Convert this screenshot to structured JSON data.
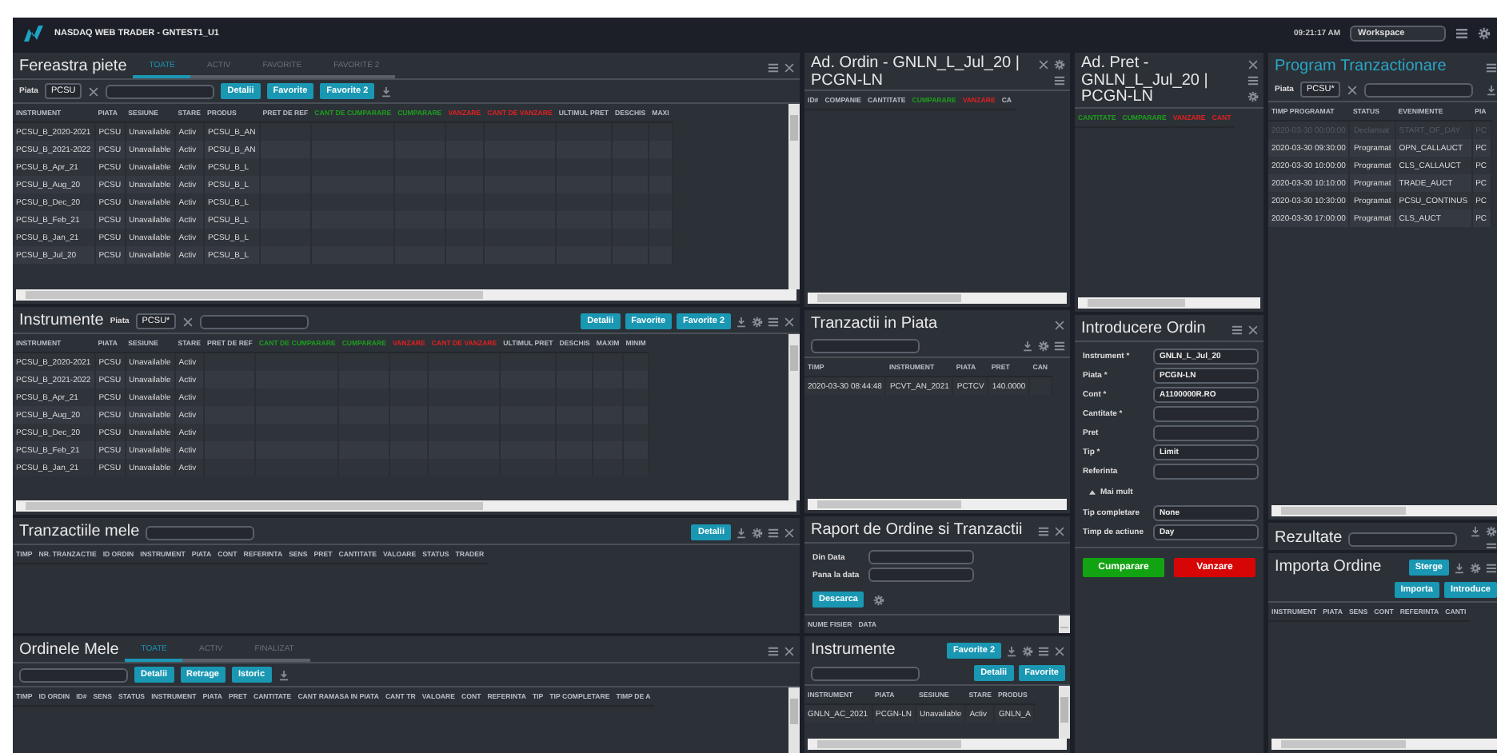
{
  "header": {
    "title": "NASDAQ WEB TRADER - GNTEST1_U1",
    "clock": "09:21:17 AM",
    "workspace": "Workspace",
    "tools": [
      {
        "kind": "menu"
      },
      {
        "kind": "settings"
      }
    ]
  },
  "workspace_columns": [
    {
      "panels": [
        {
          "title": "Fereastra piete",
          "tabs": [
            {
              "label": "TOATE",
              "selected": true
            },
            {
              "label": "ACTIV",
              "selected": false
            },
            {
              "label": "FAVORITE",
              "selected": false
            },
            {
              "label": "FAVORITE 2",
              "selected": false
            }
          ],
          "actions": [
            {
              "kind": "menu"
            },
            {
              "kind": "close"
            }
          ],
          "toolbar": [
            {
              "kind": "label",
              "label": "Piata"
            },
            {
              "kind": "select",
              "value": "PCSU"
            },
            {
              "kind": "clear"
            },
            {
              "kind": "search"
            },
            {
              "kind": "button",
              "label": "Detalii"
            },
            {
              "kind": "button",
              "label": "Favorite"
            },
            {
              "kind": "button",
              "label": "Favorite 2"
            },
            {
              "kind": "download"
            }
          ],
          "table": {
            "vscroll": true,
            "hscroll": true,
            "columns": [
              {
                "label": "INSTRUMENT"
              },
              {
                "label": "PIATA"
              },
              {
                "label": "SESIUNE"
              },
              {
                "label": "STARE"
              },
              {
                "label": "PRODUS"
              },
              {
                "label": "PRET DE REF"
              },
              {
                "label": "CANT DE CUMPARARE",
                "color": "#1e9e1e"
              },
              {
                "label": "CUMPARARE",
                "color": "#1e9e1e"
              },
              {
                "label": "VANZARE",
                "color": "#e02020"
              },
              {
                "label": "CANT DE VANZARE",
                "color": "#e02020"
              },
              {
                "label": "ULTIMUL PRET"
              },
              {
                "label": "DESCHIS"
              },
              {
                "label": "MAXI"
              }
            ],
            "rows": [
              {
                "cells": [
                  "PCSU_B_2020-2021",
                  "PCSU",
                  "Unavailable",
                  "Activ",
                  "PCSU_B_AN"
                ]
              },
              {
                "cells": [
                  "PCSU_B_2021-2022",
                  "PCSU",
                  "Unavailable",
                  "Activ",
                  "PCSU_B_AN"
                ]
              },
              {
                "cells": [
                  "PCSU_B_Apr_21",
                  "PCSU",
                  "Unavailable",
                  "Activ",
                  "PCSU_B_L"
                ]
              },
              {
                "cells": [
                  "PCSU_B_Aug_20",
                  "PCSU",
                  "Unavailable",
                  "Activ",
                  "PCSU_B_L"
                ]
              },
              {
                "cells": [
                  "PCSU_B_Dec_20",
                  "PCSU",
                  "Unavailable",
                  "Activ",
                  "PCSU_B_L"
                ]
              },
              {
                "cells": [
                  "PCSU_B_Feb_21",
                  "PCSU",
                  "Unavailable",
                  "Activ",
                  "PCSU_B_L"
                ]
              },
              {
                "cells": [
                  "PCSU_B_Jan_21",
                  "PCSU",
                  "Unavailable",
                  "Activ",
                  "PCSU_B_L"
                ]
              },
              {
                "cells": [
                  "PCSU_B_Jul_20",
                  "PCSU",
                  "Unavailable",
                  "Activ",
                  "PCSU_B_L"
                ]
              }
            ]
          }
        },
        {
          "title": "Instrumente",
          "filters": [
            {
              "kind": "label",
              "label": "Piata"
            },
            {
              "kind": "select",
              "value": "PCSU*"
            },
            {
              "kind": "clear"
            },
            {
              "kind": "search"
            }
          ],
          "actions": [
            {
              "kind": "button",
              "label": "Detalii"
            },
            {
              "kind": "button",
              "label": "Favorite"
            },
            {
              "kind": "button",
              "label": "Favorite 2"
            },
            {
              "kind": "download"
            },
            {
              "kind": "settings"
            },
            {
              "kind": "menu"
            },
            {
              "kind": "close"
            }
          ],
          "table": {
            "vscroll": true,
            "hscroll": true,
            "columns": [
              {
                "label": "INSTRUMENT"
              },
              {
                "label": "PIATA"
              },
              {
                "label": "SESIUNE"
              },
              {
                "label": "STARE"
              },
              {
                "label": "PRET DE REF"
              },
              {
                "label": "CANT DE CUMPARARE",
                "color": "#1e9e1e"
              },
              {
                "label": "CUMPARARE",
                "color": "#1e9e1e"
              },
              {
                "label": "VANZARE",
                "color": "#e02020"
              },
              {
                "label": "CANT DE VANZARE",
                "color": "#e02020"
              },
              {
                "label": "ULTIMUL PRET"
              },
              {
                "label": "DESCHIS"
              },
              {
                "label": "MAXIM"
              },
              {
                "label": "MINIM"
              }
            ],
            "rows": [
              {
                "cells": [
                  "PCSU_B_2020-2021",
                  "PCSU",
                  "Unavailable",
                  "Activ"
                ]
              },
              {
                "cells": [
                  "PCSU_B_2021-2022",
                  "PCSU",
                  "Unavailable",
                  "Activ"
                ]
              },
              {
                "cells": [
                  "PCSU_B_Apr_21",
                  "PCSU",
                  "Unavailable",
                  "Activ"
                ]
              },
              {
                "cells": [
                  "PCSU_B_Aug_20",
                  "PCSU",
                  "Unavailable",
                  "Activ"
                ]
              },
              {
                "cells": [
                  "PCSU_B_Dec_20",
                  "PCSU",
                  "Unavailable",
                  "Activ"
                ]
              },
              {
                "cells": [
                  "PCSU_B_Feb_21",
                  "PCSU",
                  "Unavailable",
                  "Activ"
                ]
              },
              {
                "cells": [
                  "PCSU_B_Jan_21",
                  "PCSU",
                  "Unavailable",
                  "Activ"
                ]
              }
            ]
          }
        },
        {
          "title": "Tranzactiile mele",
          "filters": [
            {
              "kind": "search"
            }
          ],
          "actions": [
            {
              "kind": "button",
              "label": "Detalii"
            },
            {
              "kind": "download"
            },
            {
              "kind": "settings"
            },
            {
              "kind": "menu"
            },
            {
              "kind": "close"
            }
          ],
          "table": {
            "columns": [
              {
                "label": "TIMP"
              },
              {
                "label": "NR. TRANZACTIE"
              },
              {
                "label": "ID ORDIN"
              },
              {
                "label": "INSTRUMENT"
              },
              {
                "label": "PIATA"
              },
              {
                "label": "CONT"
              },
              {
                "label": "REFERINTA"
              },
              {
                "label": "SENS"
              },
              {
                "label": "PRET"
              },
              {
                "label": "CANTITATE"
              },
              {
                "label": "VALOARE"
              },
              {
                "label": "STATUS"
              },
              {
                "label": "TRADER"
              }
            ]
          }
        },
        {
          "title": "Ordinele Mele",
          "tabs": [
            {
              "label": "TOATE",
              "selected": true
            },
            {
              "label": "ACTIV",
              "selected": false
            },
            {
              "label": "FINALIZAT",
              "selected": false
            }
          ],
          "actions": [
            {
              "kind": "menu"
            },
            {
              "kind": "close"
            }
          ],
          "toolbar": [
            {
              "kind": "search"
            },
            {
              "kind": "button",
              "label": "Detalii"
            },
            {
              "kind": "button",
              "label": "Retrage"
            },
            {
              "kind": "button",
              "label": "Istoric"
            },
            {
              "kind": "download"
            }
          ],
          "table": {
            "vscroll": true,
            "columns": [
              {
                "label": "TIMP"
              },
              {
                "label": "ID ORDIN"
              },
              {
                "label": "ID#"
              },
              {
                "label": "SENS"
              },
              {
                "label": "STATUS"
              },
              {
                "label": "INSTRUMENT"
              },
              {
                "label": "PIATA"
              },
              {
                "label": "PRET"
              },
              {
                "label": "CANTITATE"
              },
              {
                "label": "CANT RAMASA IN PIATA"
              },
              {
                "label": "CANT TR"
              },
              {
                "label": "VALOARE"
              },
              {
                "label": "CONT"
              },
              {
                "label": "REFERINTA"
              },
              {
                "label": "TIP"
              },
              {
                "label": "TIP COMPLETARE"
              },
              {
                "label": "TIMP DE A"
              }
            ]
          }
        }
      ]
    },
    {
      "panels": [
        {
          "title": "Ad. Ordin - GNLN_L_Jul_20 | PCGN-LN",
          "actions": [
            {
              "kind": "close"
            },
            {
              "kind": "settings"
            },
            {
              "kind": "menu"
            }
          ],
          "table": {
            "hscroll": true,
            "columns": [
              {
                "label": "ID#"
              },
              {
                "label": "COMPANIE"
              },
              {
                "label": "CANTITATE"
              },
              {
                "label": "CUMPARARE",
                "color": "#1e9e1e"
              },
              {
                "label": "VANZARE",
                "color": "#e02020"
              },
              {
                "label": "CA"
              }
            ]
          }
        },
        {
          "title": "Tranzactii in Piata",
          "actions": [
            {
              "kind": "close"
            }
          ],
          "toolbar": [
            {
              "kind": "search"
            }
          ],
          "toolbar_actions": [
            {
              "kind": "download"
            },
            {
              "kind": "settings"
            },
            {
              "kind": "menu"
            }
          ],
          "table": {
            "hscroll": true,
            "columns": [
              {
                "label": "TIMP"
              },
              {
                "label": "INSTRUMENT"
              },
              {
                "label": "PIATA"
              },
              {
                "label": "PRET"
              },
              {
                "label": "CAN"
              }
            ],
            "rows": [
              {
                "cells": [
                  "2020-03-30 08:44:48",
                  "PCVT_AN_2021",
                  "PCTCV",
                  "140.0000"
                ]
              }
            ]
          }
        },
        {
          "title": "Raport de Ordine si Tranzactii",
          "actions": [
            {
              "kind": "menu"
            },
            {
              "kind": "close"
            }
          ],
          "form": {
            "fields": [
              {
                "label": "Din Data"
              },
              {
                "label": "Pana la data"
              }
            ],
            "actions": [
              {
                "kind": "button",
                "label": "Descarca"
              },
              {
                "kind": "settings"
              }
            ]
          },
          "table": {
            "vscroll": true,
            "columns": [
              {
                "label": "NUME FISIER"
              },
              {
                "label": "DATA"
              }
            ]
          }
        },
        {
          "title": "Instrumente",
          "actions": [
            {
              "kind": "button",
              "label": "Favorite 2"
            },
            {
              "kind": "download"
            },
            {
              "kind": "settings"
            },
            {
              "kind": "menu"
            },
            {
              "kind": "close"
            }
          ],
          "toolbar": [
            {
              "kind": "search"
            }
          ],
          "toolbar_actions": [
            {
              "kind": "button",
              "label": "Detalii"
            },
            {
              "kind": "button",
              "label": "Favorite"
            }
          ],
          "table": {
            "vscroll": true,
            "hscroll": true,
            "columns": [
              {
                "label": "INSTRUMENT"
              },
              {
                "label": "PIATA"
              },
              {
                "label": "SESIUNE"
              },
              {
                "label": "STARE"
              },
              {
                "label": "PRODUS"
              }
            ],
            "rows": [
              {
                "cells": [
                  "GNLN_AC_2021",
                  "PCGN-LN",
                  "Unavailable",
                  "Activ",
                  "GNLN_A"
                ]
              }
            ]
          }
        }
      ]
    },
    {
      "panels": [
        {
          "title": "Ad. Pret - GNLN_L_Jul_20 | PCGN-LN",
          "actions": [
            {
              "kind": "close"
            },
            {
              "kind": "menu"
            },
            {
              "kind": "settings"
            }
          ],
          "table": {
            "hscroll": true,
            "columns": [
              {
                "label": "CANTITATE",
                "color": "#1e9e1e"
              },
              {
                "label": "CUMPARARE",
                "color": "#1e9e1e"
              },
              {
                "label": "VANZARE",
                "color": "#e02020"
              },
              {
                "label": "CANT",
                "color": "#e02020"
              }
            ]
          }
        },
        {
          "title": "Introducere Ordin",
          "actions": [
            {
              "kind": "menu"
            },
            {
              "kind": "close"
            }
          ],
          "form": {
            "fields": [
              {
                "label": "Instrument *",
                "value": "GNLN_L_Jul_20"
              },
              {
                "label": "Piata *",
                "value": "PCGN-LN"
              },
              {
                "label": "Cont *",
                "value": "A1100000R.RO"
              },
              {
                "label": "Cantitate *"
              },
              {
                "label": "Pret"
              },
              {
                "label": "Tip *",
                "value": "Limit"
              },
              {
                "label": "Referinta"
              }
            ],
            "toggle": {
              "label": "Mai mult",
              "expanded": true
            },
            "extra_fields": [
              {
                "label": "Tip completare",
                "value": "None"
              },
              {
                "label": "Timp de actiune",
                "value": "Day"
              }
            ],
            "actions": [
              {
                "kind": "buy",
                "label": "Cumparare"
              },
              {
                "kind": "sell",
                "label": "Vanzare"
              }
            ]
          }
        }
      ]
    },
    {
      "panels": [
        {
          "title": "Program Tranzactionare",
          "title_highlighted": true,
          "actions": [
            {
              "kind": "menu"
            }
          ],
          "toolbar": [
            {
              "kind": "label",
              "label": "Piata"
            },
            {
              "kind": "select",
              "value": "PCSU*"
            },
            {
              "kind": "clear"
            },
            {
              "kind": "search"
            }
          ],
          "toolbar_actions": [
            {
              "kind": "download"
            }
          ],
          "table": {
            "hscroll": true,
            "columns": [
              {
                "label": "TIMP PROGRAMAT"
              },
              {
                "label": "STATUS"
              },
              {
                "label": "EVENIMENTE"
              },
              {
                "label": "PIA"
              }
            ],
            "rows": [
              {
                "completed": true,
                "cells": [
                  "2020-03-30 00:00:00",
                  "Declansat",
                  "START_OF_DAY",
                  "PC"
                ]
              },
              {
                "completed": false,
                "cells": [
                  "2020-03-30 09:30:00",
                  "Programat",
                  "OPN_CALLAUCT",
                  "PC"
                ]
              },
              {
                "completed": false,
                "cells": [
                  "2020-03-30 10:00:00",
                  "Programat",
                  "CLS_CALLAUCT",
                  "PC"
                ]
              },
              {
                "completed": false,
                "cells": [
                  "2020-03-30 10:10:00",
                  "Programat",
                  "TRADE_AUCT",
                  "PC"
                ]
              },
              {
                "completed": false,
                "cells": [
                  "2020-03-30 10:30:00",
                  "Programat",
                  "PCSU_CONTINUS",
                  "PC"
                ]
              },
              {
                "completed": false,
                "cells": [
                  "2020-03-30 17:00:00",
                  "Programat",
                  "CLS_AUCT",
                  "PC"
                ]
              }
            ]
          }
        },
        {
          "title": "Rezultate",
          "filters": [
            {
              "kind": "search"
            }
          ],
          "actions": [
            {
              "kind": "download"
            },
            {
              "kind": "settings"
            },
            {
              "kind": "menu"
            }
          ]
        },
        {
          "title": "Importa Ordine",
          "actions": [
            {
              "kind": "button",
              "label": "Sterge"
            },
            {
              "kind": "download"
            },
            {
              "kind": "settings"
            },
            {
              "kind": "menu"
            }
          ],
          "toolbar_actions": [
            {
              "kind": "button",
              "label": "Importa"
            },
            {
              "kind": "button",
              "label": "Introduce"
            }
          ],
          "table": {
            "hscroll": true,
            "columns": [
              {
                "label": "INSTRUMENT"
              },
              {
                "label": "PIATA"
              },
              {
                "label": "SENS"
              },
              {
                "label": "CONT"
              },
              {
                "label": "REFERINTA"
              },
              {
                "label": "CANTI"
              }
            ]
          }
        }
      ]
    }
  ]
}
